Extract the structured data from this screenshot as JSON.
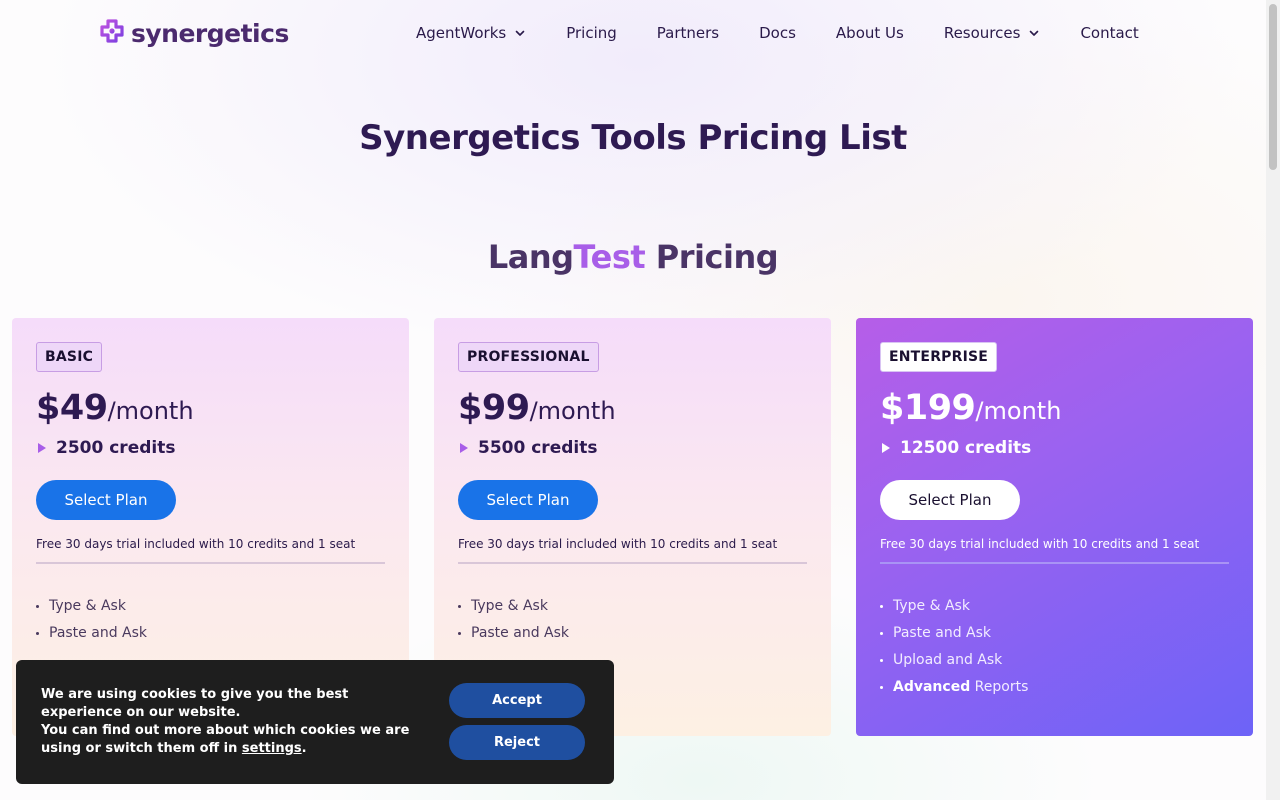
{
  "header": {
    "logo_text": "synergetics",
    "nav": [
      {
        "label": "AgentWorks",
        "has_dropdown": true
      },
      {
        "label": "Pricing",
        "has_dropdown": false
      },
      {
        "label": "Partners",
        "has_dropdown": false
      },
      {
        "label": "Docs",
        "has_dropdown": false
      },
      {
        "label": "About Us",
        "has_dropdown": false
      },
      {
        "label": "Resources",
        "has_dropdown": true
      },
      {
        "label": "Contact",
        "has_dropdown": false
      }
    ]
  },
  "page_title": "Synergetics Tools Pricing List",
  "section_title": {
    "part1": "Lang",
    "accent": "Test",
    "part2": " Pricing"
  },
  "plans": [
    {
      "badge": "BASIC",
      "price": "$49",
      "period": "/month",
      "credits": "2500 credits",
      "button": "Select Plan",
      "trial": "Free 30 days trial included with 10 credits and 1 seat",
      "features": [
        "Type & Ask",
        "Paste and Ask"
      ]
    },
    {
      "badge": "PROFESSIONAL",
      "price": "$99",
      "period": "/month",
      "credits": "5500 credits",
      "button": "Select Plan",
      "trial": "Free 30 days trial included with 10 credits and 1 seat",
      "features": [
        "Type & Ask",
        "Paste and Ask"
      ]
    },
    {
      "badge": "ENTERPRISE",
      "price": "$199",
      "period": "/month",
      "credits": "12500 credits",
      "button": "Select Plan",
      "trial": "Free 30 days trial included with 10 credits and 1 seat",
      "features": [
        "Type & Ask",
        "Paste and Ask",
        "Upload and Ask"
      ],
      "extra_feature": {
        "bold": "Advanced",
        "rest": " Reports"
      }
    }
  ],
  "cookie": {
    "line1": "We are using cookies to give you the best experience on our website.",
    "line2": "You can find out more about which cookies we are using or switch them off in ",
    "link": "settings",
    "end": ".",
    "accept": "Accept",
    "reject": "Reject"
  },
  "colors": {
    "accent_purple": "#a85ee8",
    "primary_button": "#1973e8",
    "title_dark": "#2e1a52"
  }
}
